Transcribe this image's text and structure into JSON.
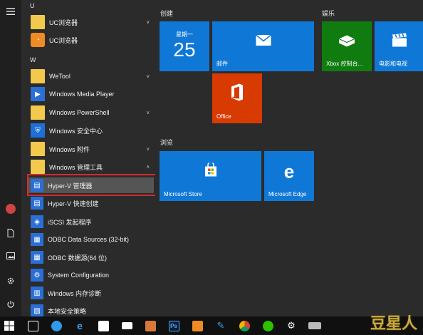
{
  "rail": {
    "menu_icon": "hamburger-icon",
    "icons": [
      "avatar",
      "document-icon",
      "pictures-icon",
      "settings-icon",
      "power-icon"
    ]
  },
  "applist": {
    "letter_u": "U",
    "uc1": "UC浏览器",
    "uc2": "UC浏览器",
    "letter_w": "W",
    "wetool": "WeTool",
    "wmp": "Windows Media Player",
    "wps": "Windows PowerShell",
    "wsec": "Windows 安全中心",
    "wacc": "Windows 附件",
    "wadmin": "Windows 管理工具",
    "hyperv_mgr": "Hyper-V 管理器",
    "hyperv_quick": "Hyper-V 快速创建",
    "iscsi": "iSCSI 发起程序",
    "odbc32": "ODBC Data Sources (32-bit)",
    "odbc": "ODBC 数据源(64 位)",
    "syscfg": "System Configuration",
    "memdiag": "Windows 内存诊断",
    "localsec": "本地安全策略"
  },
  "tiles": {
    "group_create": "创建",
    "group_play": "娱乐",
    "group_browse": "浏览",
    "calendar_day": "星期一",
    "calendar_date": "25",
    "mail": "邮件",
    "office": "Office",
    "xbox": "Xbox 控制台...",
    "movies": "电影和电视",
    "store": "Microsoft Store",
    "edge": "Microsoft Edge"
  },
  "watermark": "豆星人",
  "colors": {
    "tile_blue": "#0f78d7",
    "tile_green": "#107c10",
    "tile_orange": "#d83b01",
    "highlight_red": "#d92a2a"
  }
}
